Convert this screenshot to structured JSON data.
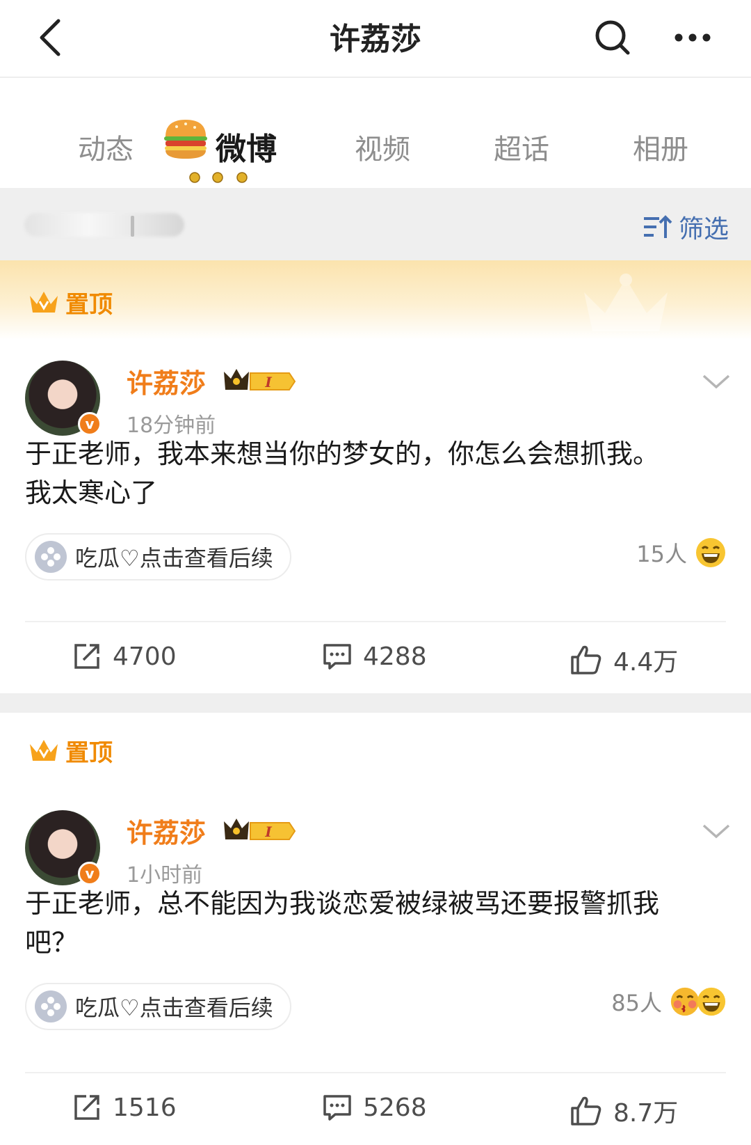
{
  "header": {
    "title": "许荔莎"
  },
  "tabs": [
    {
      "label": "动态"
    },
    {
      "label": "微博"
    },
    {
      "label": "视频"
    },
    {
      "label": "超话"
    },
    {
      "label": "相册"
    }
  ],
  "filter": {
    "label": "筛选"
  },
  "posts": [
    {
      "pin_label": "置顶",
      "username": "许荔莎",
      "vip_level": "I",
      "time": "18分钟前",
      "content_line1": "于正老师，我本来想当你的梦女的，你怎么会想抓我。",
      "content_line2": "我太寒心了",
      "topic": "吃瓜♡点击查看后续",
      "reactors": "15人",
      "reposts": "4700",
      "comments": "4288",
      "likes": "4.4万"
    },
    {
      "pin_label": "置顶",
      "username": "许荔莎",
      "vip_level": "I",
      "time": "1小时前",
      "content_line1": "于正老师，总不能因为我谈恋爱被绿被骂还要报警抓我",
      "content_line2": "吧？",
      "topic": "吃瓜♡点击查看后续",
      "reactors": "85人",
      "reposts": "1516",
      "comments": "5268",
      "likes": "8.7万"
    }
  ],
  "colors": {
    "accent_orange": "#f07d1a",
    "link_blue": "#456FB0",
    "pin_gold": "#f08a00"
  }
}
